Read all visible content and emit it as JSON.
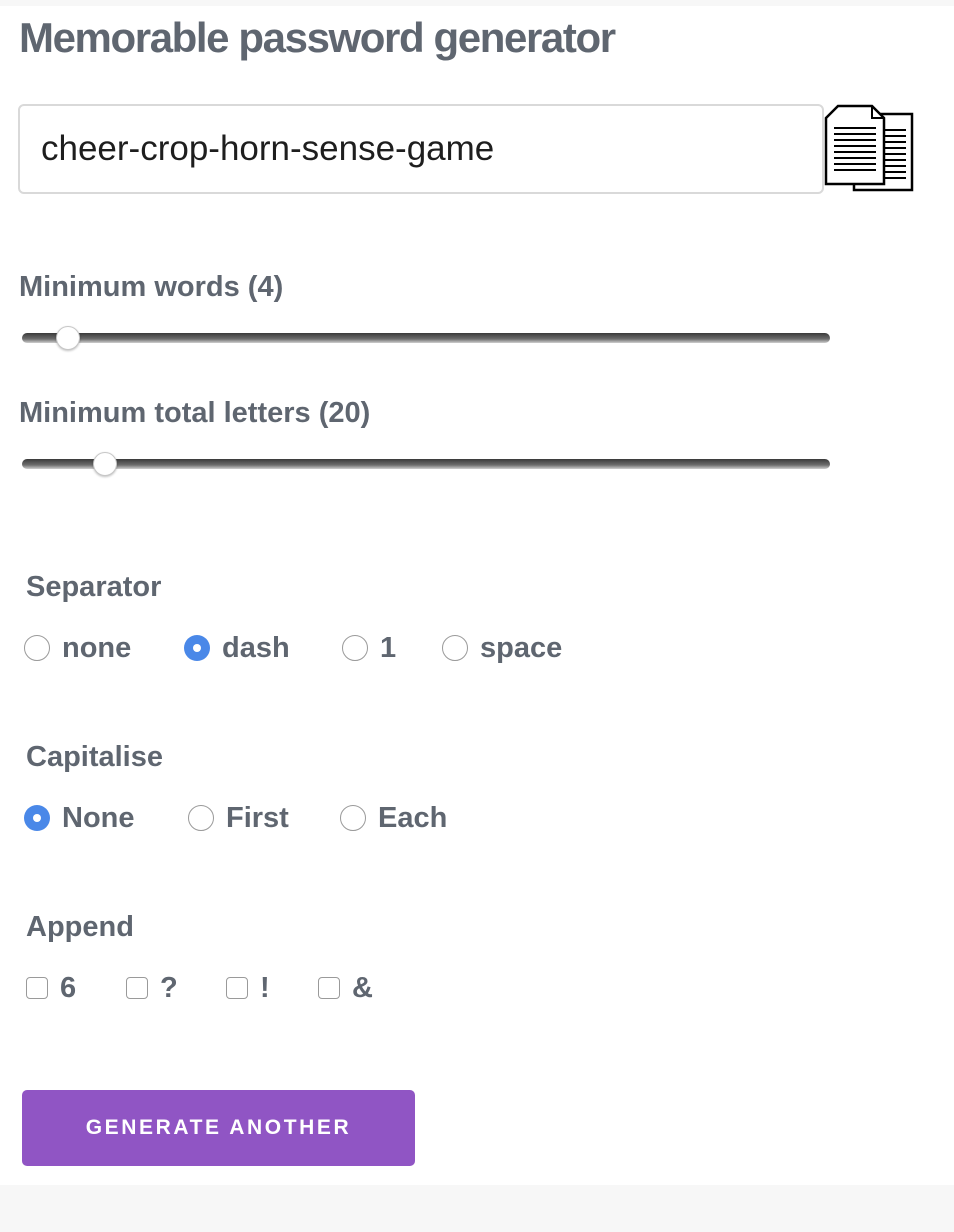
{
  "title": "Memorable password generator",
  "password": {
    "value": "cheer-crop-horn-sense-game"
  },
  "copy": {
    "icon": "copy-documents-icon"
  },
  "min_words": {
    "label": "Minimum words (4)",
    "value": 4,
    "level_fraction": 0.057
  },
  "min_letters": {
    "label": "Minimum total letters (20)",
    "value": 20,
    "level_fraction": 0.103
  },
  "separator": {
    "heading": "Separator",
    "options": [
      {
        "label": "none",
        "selected": false
      },
      {
        "label": "dash",
        "selected": true
      },
      {
        "label": "1",
        "selected": false
      },
      {
        "label": "space",
        "selected": false
      }
    ]
  },
  "capitalise": {
    "heading": "Capitalise",
    "options": [
      {
        "label": "None",
        "selected": true
      },
      {
        "label": "First",
        "selected": false
      },
      {
        "label": "Each",
        "selected": false
      }
    ]
  },
  "append": {
    "heading": "Append",
    "options": [
      {
        "label": "6",
        "checked": false
      },
      {
        "label": "?",
        "checked": false
      },
      {
        "label": "!",
        "checked": false
      },
      {
        "label": "&",
        "checked": false
      }
    ]
  },
  "generate_button": {
    "label": "GENERATE ANOTHER"
  },
  "colors": {
    "accent": "#9055c4",
    "radio_selected": "#4a88e8",
    "text": "#5f6670"
  }
}
